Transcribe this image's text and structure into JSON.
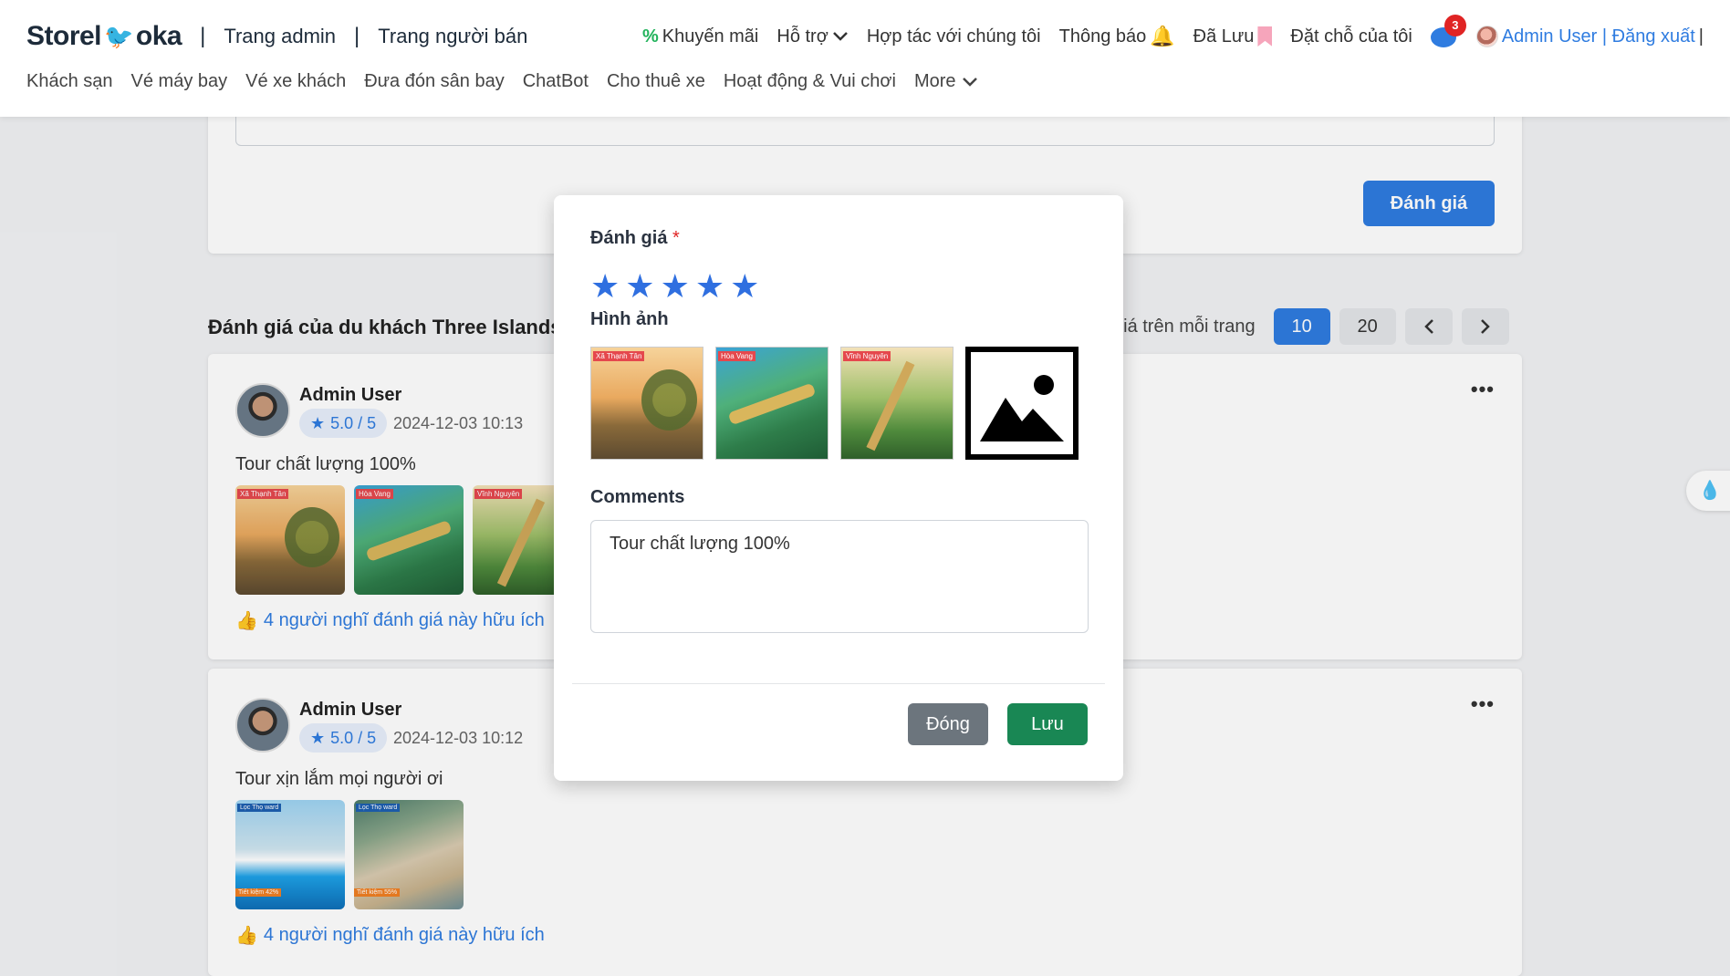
{
  "header": {
    "logo_left": "Storel",
    "logo_right": "oka",
    "admin_link": "Trang admin",
    "seller_link": "Trang người bán",
    "promo": "Khuyến mãi",
    "support": "Hỗ trợ",
    "partner": "Hợp tác với chúng tôi",
    "notifications": "Thông báo",
    "saved": "Đã Lưu",
    "bookings": "Đặt chỗ của tôi",
    "chat_badge": "3",
    "user": "Admin User | Đăng xuất",
    "user_sep": "|",
    "separator": "|"
  },
  "nav": {
    "items": [
      "Khách sạn",
      "Vé máy bay",
      "Vé xe khách",
      "Đưa đón sân bay",
      "ChatBot",
      "Cho thuê xe",
      "Hoạt động & Vui chơi"
    ],
    "more": "More"
  },
  "page": {
    "rate_button": "Đánh giá",
    "section_title": "Đánh giá của du khách Three Islands",
    "per_page_label": "giá trên mỗi trang",
    "per_page_options": [
      "10",
      "20"
    ],
    "prev": "‹",
    "next": "›"
  },
  "reviews": [
    {
      "name": "Admin User",
      "score": "5.0 / 5",
      "date": "2024-12-03 10:13",
      "text": "Tour chất lượng 100%",
      "helpful": "4 người nghĩ đánh giá này hữu ích",
      "image_tags": [
        "Xã Thạnh Tân",
        "Hòa Vang",
        "Vĩnh Nguyên"
      ]
    },
    {
      "name": "Admin User",
      "score": "5.0 / 5",
      "date": "2024-12-03 10:12",
      "text": "Tour xịn lắm mọi người ơi",
      "helpful": "4 người nghĩ đánh giá này hữu ích",
      "image_tags": [
        "Lọc Thọ ward",
        "Lọc Thọ ward"
      ],
      "image_badges": [
        "Tiết kiệm 42%",
        "Tiết kiệm 55%"
      ]
    }
  ],
  "modal": {
    "rating_label": "Đánh giá",
    "required_mark": "*",
    "rating_value": 5,
    "images_label": "Hình ảnh",
    "image_tags": [
      "Xã Thạnh Tân",
      "Hòa Vang",
      "Vĩnh Nguyên"
    ],
    "comments_label": "Comments",
    "comment_value": "Tour chất lượng 100%",
    "close_button": "Đóng",
    "save_button": "Lưu"
  },
  "colors": {
    "primary": "#2f7ce0",
    "success": "#198754",
    "secondary": "#6c757d",
    "danger": "#e02424"
  }
}
